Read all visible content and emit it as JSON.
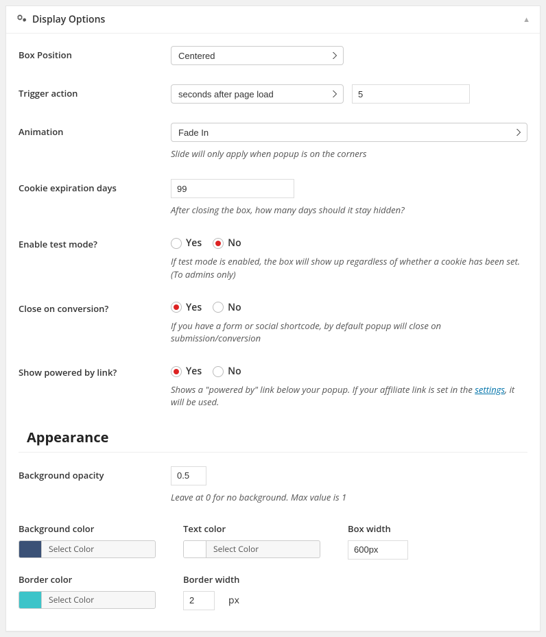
{
  "panel": {
    "title": "Display Options"
  },
  "labels": {
    "box_position": "Box Position",
    "trigger_action": "Trigger action",
    "animation": "Animation",
    "cookie_days": "Cookie expiration days",
    "test_mode": "Enable test mode?",
    "close_conv": "Close on conversion?",
    "powered": "Show powered by link?",
    "bg_opacity": "Background opacity",
    "bg_color": "Background color",
    "text_color": "Text color",
    "box_width": "Box width",
    "border_color": "Border color",
    "border_width": "Border width"
  },
  "box_position": {
    "selected": "Centered"
  },
  "trigger": {
    "selected": "seconds after page load",
    "value": "5"
  },
  "animation": {
    "selected": "Fade In",
    "help": "Slide will only apply when popup is on the corners"
  },
  "cookie": {
    "value": "99",
    "help": "After closing the box, how many days should it stay hidden?"
  },
  "radio_labels": {
    "yes": "Yes",
    "no": "No"
  },
  "test_mode": {
    "value": "no",
    "help": "If test mode is enabled, the box will show up regardless of whether a cookie has been set. (To admins only)"
  },
  "close_conv": {
    "value": "yes",
    "help": "If you have a form or social shortcode, by default popup will close on submission/conversion"
  },
  "powered": {
    "value": "yes",
    "help_prefix": "Shows a \"powered by\" link below your popup. If your affiliate link is set in the ",
    "link_text": "settings",
    "help_suffix": ", it will be used."
  },
  "section": {
    "appearance": "Appearance"
  },
  "bg_opacity": {
    "value": "0.5",
    "help": "Leave at 0 for no background. Max value is 1"
  },
  "colors": {
    "select_label": "Select Color",
    "bg": "#3b5176",
    "text": "#ffffff",
    "border": "#3cc4c9"
  },
  "box_width": {
    "value": "600px"
  },
  "border_width": {
    "value": "2",
    "unit": "px"
  }
}
